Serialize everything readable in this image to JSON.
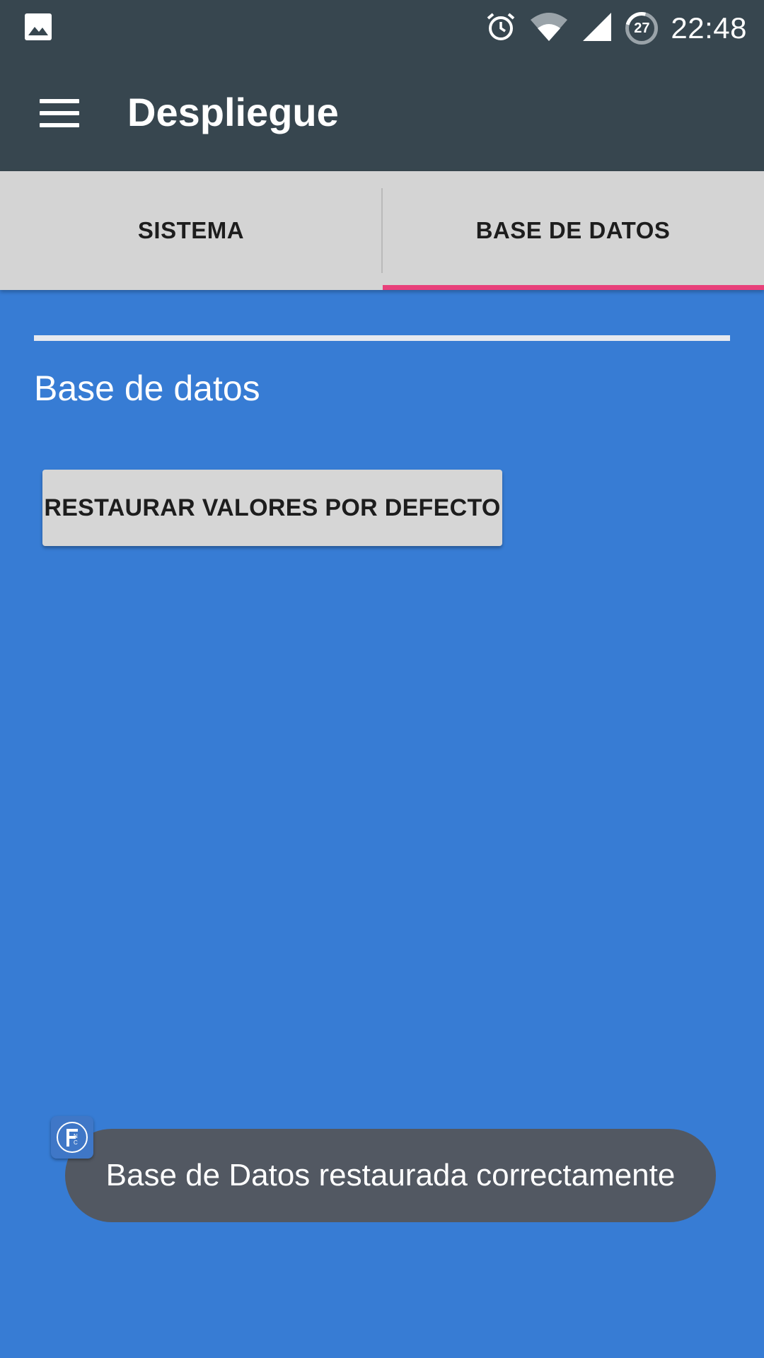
{
  "status_bar": {
    "time": "22:48",
    "battery_level": "27",
    "icons": [
      "image-icon",
      "alarm-icon",
      "wifi-icon",
      "signal-icon",
      "battery-icon"
    ]
  },
  "app_bar": {
    "title": "Despliegue",
    "menu_icon": "hamburger-menu-icon"
  },
  "tabs": {
    "items": [
      {
        "label": "SISTEMA",
        "selected": false
      },
      {
        "label": "BASE DE DATOS",
        "selected": true
      }
    ],
    "indicator_color": "#E8407A"
  },
  "content": {
    "section_title": "Base de datos",
    "restore_button_label": "RESTAURAR VALORES POR DEFECTO"
  },
  "toast": {
    "message": "Base de Datos restaurada correctamente",
    "app_icon": "fnc-app-icon"
  },
  "colors": {
    "toolbar": "#37464F",
    "background": "#377CD4",
    "tab_bar": "#D4D4D4",
    "toast": "#525862"
  }
}
